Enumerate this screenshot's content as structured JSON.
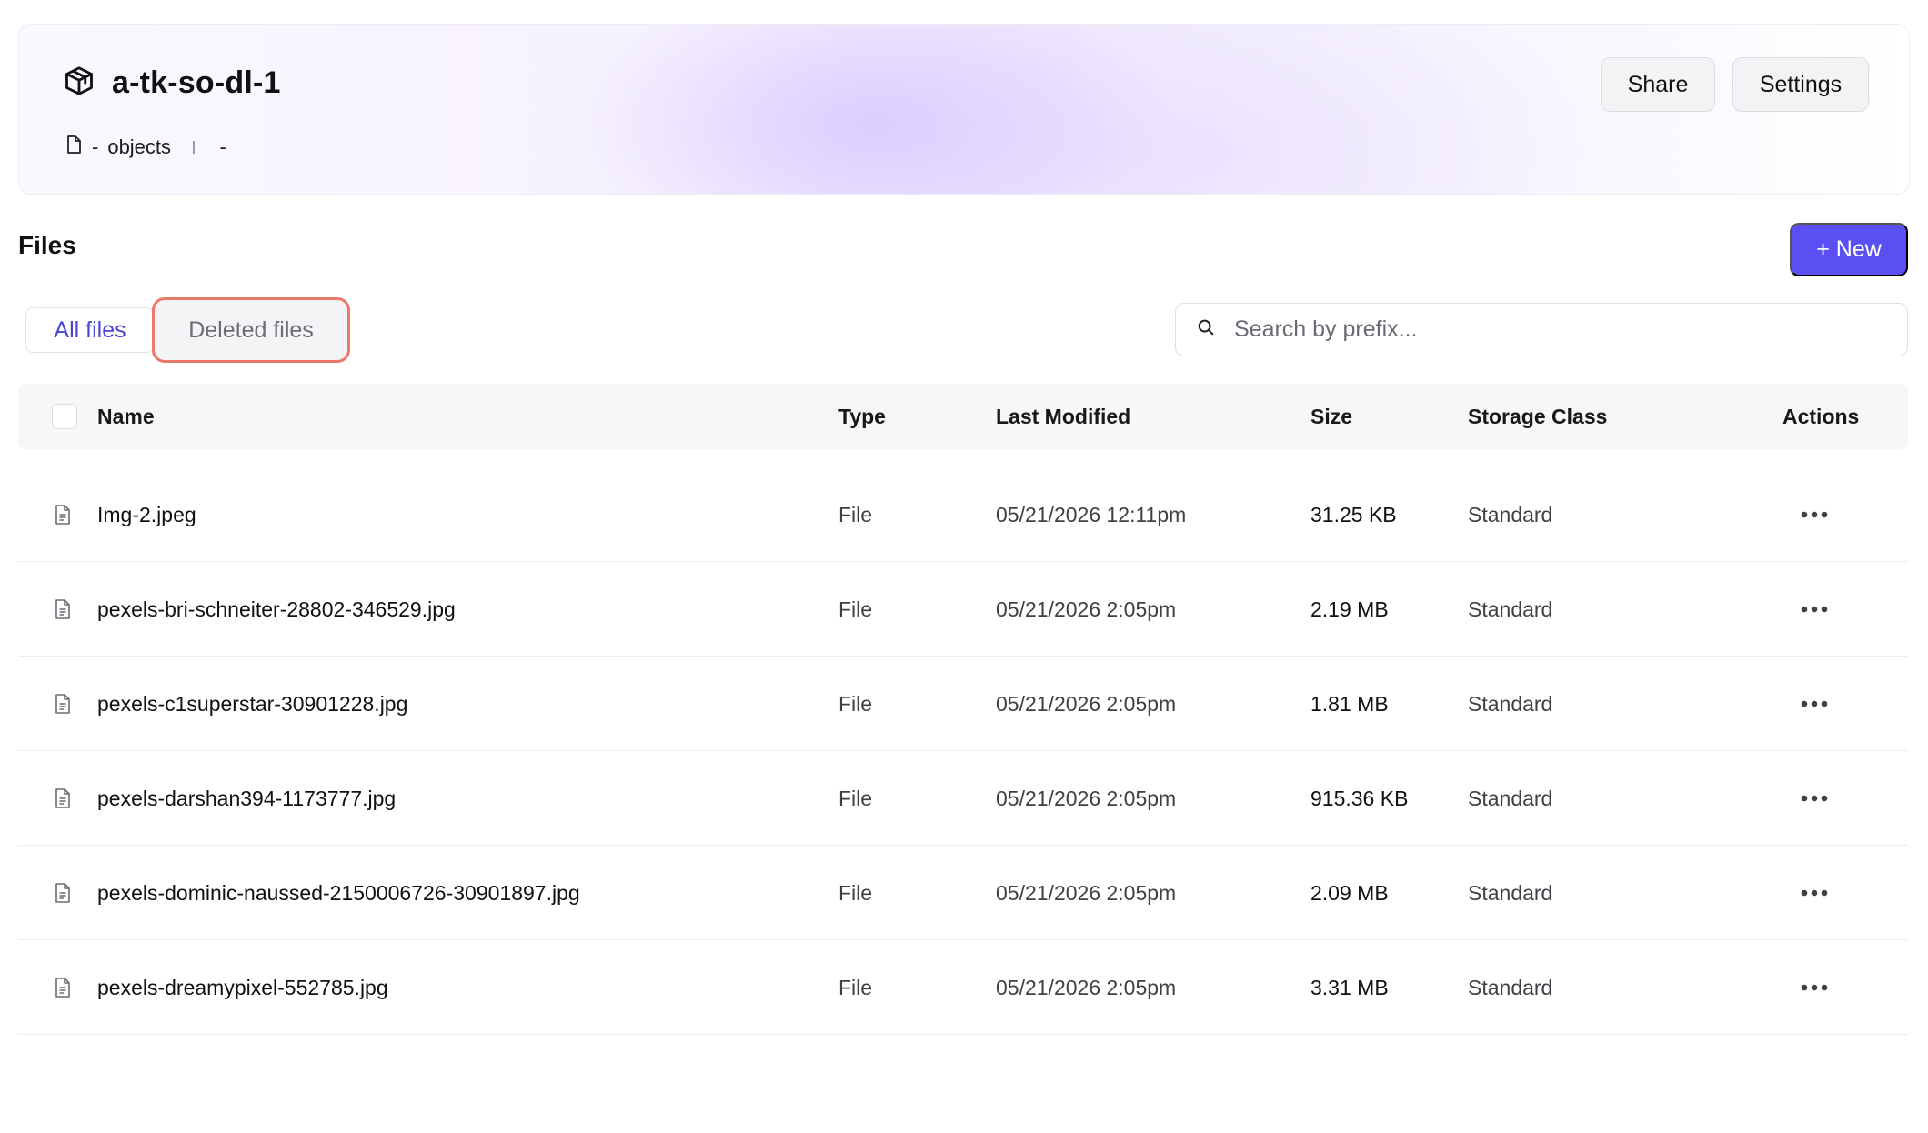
{
  "bucket": {
    "name": "a-tk-so-dl-1",
    "objects_count": "-",
    "objects_label": "objects",
    "size": "-",
    "icon": "cube-icon",
    "object_icon": "file-icon"
  },
  "header_buttons": {
    "share": "Share",
    "settings": "Settings"
  },
  "files": {
    "heading": "Files",
    "new_button": "+ New",
    "tabs": {
      "all": "All files",
      "deleted": "Deleted files"
    },
    "search_placeholder": "Search by prefix..."
  },
  "table": {
    "columns": {
      "name": "Name",
      "type": "Type",
      "modified": "Last Modified",
      "size": "Size",
      "storage_class": "Storage Class",
      "actions": "Actions"
    },
    "rows": [
      {
        "name": "Img-2.jpeg",
        "type": "File",
        "modified": "05/21/2026 12:11pm",
        "size": "31.25 KB",
        "storage_class": "Standard"
      },
      {
        "name": "pexels-bri-schneiter-28802-346529.jpg",
        "type": "File",
        "modified": "05/21/2026 2:05pm",
        "size": "2.19 MB",
        "storage_class": "Standard"
      },
      {
        "name": "pexels-c1superstar-30901228.jpg",
        "type": "File",
        "modified": "05/21/2026 2:05pm",
        "size": "1.81 MB",
        "storage_class": "Standard"
      },
      {
        "name": "pexels-darshan394-1173777.jpg",
        "type": "File",
        "modified": "05/21/2026 2:05pm",
        "size": "915.36 KB",
        "storage_class": "Standard"
      },
      {
        "name": "pexels-dominic-naussed-2150006726-30901897.jpg",
        "type": "File",
        "modified": "05/21/2026 2:05pm",
        "size": "2.09 MB",
        "storage_class": "Standard"
      },
      {
        "name": "pexels-dreamypixel-552785.jpg",
        "type": "File",
        "modified": "05/21/2026 2:05pm",
        "size": "3.31 MB",
        "storage_class": "Standard"
      }
    ]
  },
  "colors": {
    "accent": "#5a4ff3",
    "tab_active_text": "#4b45d6",
    "highlight_border": "#e97a6b"
  }
}
